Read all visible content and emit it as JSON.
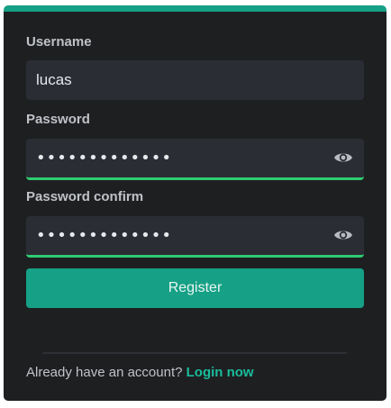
{
  "form": {
    "username": {
      "label": "Username",
      "value": "lucas"
    },
    "password": {
      "label": "Password",
      "value": "•••••••••••••",
      "icon": "eye-icon"
    },
    "password_confirm": {
      "label": "Password confirm",
      "value": "•••••••••••••",
      "icon": "eye-icon"
    },
    "register_label": "Register"
  },
  "footer": {
    "text": "Already have an account?",
    "link": "Login now"
  },
  "colors": {
    "accent": "#16a085",
    "success": "#2ecc71",
    "background": "#1e1f21",
    "input_bg": "#2a2d33"
  }
}
